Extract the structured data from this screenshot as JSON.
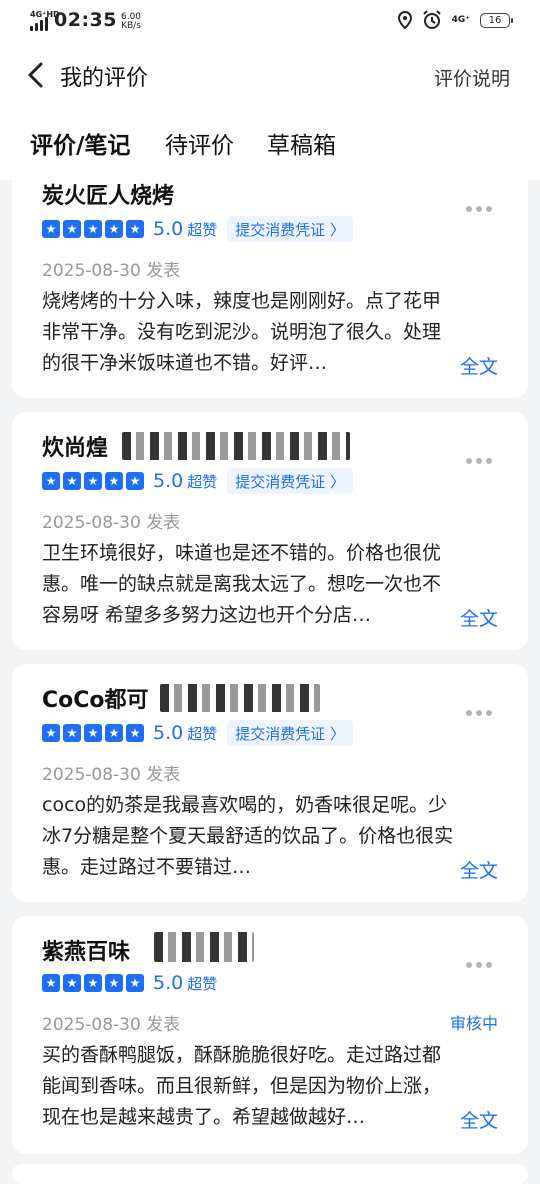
{
  "status_bar": {
    "network_tag": "4G⁺HD",
    "time": "02:35",
    "speed_value": "6.00",
    "speed_unit": "KB/s",
    "network_right": "4G⁺",
    "battery": "16"
  },
  "header": {
    "title": "我的评价",
    "help": "评价说明"
  },
  "tabs": [
    {
      "label": "评价/笔记",
      "active": true
    },
    {
      "label": "待评价",
      "active": false
    },
    {
      "label": "草稿箱",
      "active": false
    }
  ],
  "reviews": [
    {
      "shop": "炭火匠人烧烤",
      "score": "5.0",
      "score_tag": "超赞",
      "voucher": "提交消费凭证 〉",
      "date": "2025-08-30 发表",
      "status": "",
      "lines": [
        "烧烤烤的十分入味，辣度也是刚刚好。点了花甲",
        "非常干净。没有吃到泥沙。说明泡了很久。处理",
        "的很干净米饭味道也不错。好评…"
      ],
      "more": "全文"
    },
    {
      "shop": "炊尚煌",
      "score": "5.0",
      "score_tag": "超赞",
      "voucher": "提交消费凭证 〉",
      "date": "2025-08-30 发表",
      "status": "",
      "lines": [
        "卫生环境很好，味道也是还不错的。价格也很优",
        "惠。唯一的缺点就是离我太远了。想吃一次也不",
        "容易呀  希望多多努力这边也开个分店…"
      ],
      "more": "全文"
    },
    {
      "shop": "CoCo都可",
      "score": "5.0",
      "score_tag": "超赞",
      "voucher": "提交消费凭证 〉",
      "date": "2025-08-30 发表",
      "status": "",
      "lines": [
        "coco的奶茶是我最喜欢喝的，奶香味很足呢。少",
        "冰7分糖是整个夏天最舒适的饮品了。价格也很实",
        "惠。走过路过不要错过…"
      ],
      "more": "全文"
    },
    {
      "shop": "紫燕百味",
      "score": "5.0",
      "score_tag": "超赞",
      "voucher": "",
      "date": "2025-08-30 发表",
      "status": "审核中",
      "lines": [
        "买的香酥鸭腿饭，酥酥脆脆很好吃。走过路过都",
        "能闻到香味。而且很新鲜，但是因为物价上涨，",
        "现在也是越来越贵了。希望越做越好…"
      ],
      "more": "全文"
    }
  ],
  "colors": {
    "accent": "#1e6ff5",
    "muted": "#999999"
  }
}
